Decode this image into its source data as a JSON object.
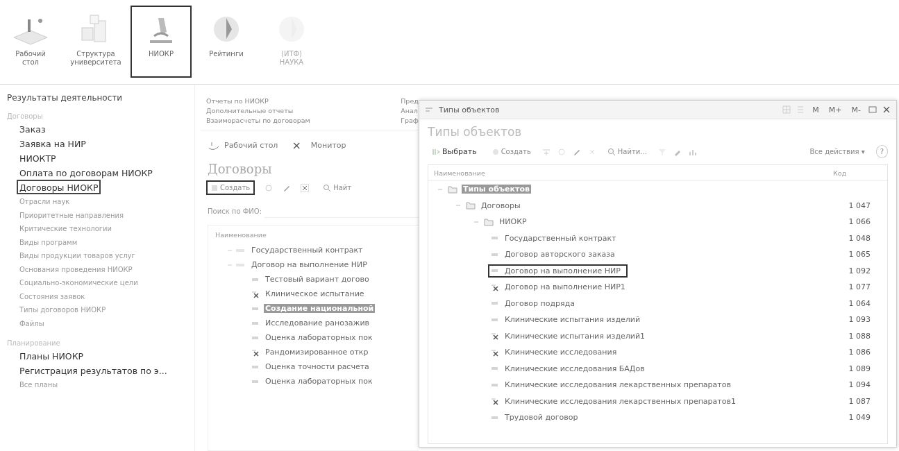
{
  "sections": [
    {
      "label": "Рабочий\nстол",
      "selected": false,
      "disabled": false
    },
    {
      "label": "Структура\nуниверситета",
      "selected": false,
      "disabled": false
    },
    {
      "label": "НИОКР",
      "selected": true,
      "disabled": false
    },
    {
      "label": "Рейтинги",
      "selected": false,
      "disabled": false
    },
    {
      "label": "(ИТФ)\nНАУКА",
      "selected": false,
      "disabled": true
    }
  ],
  "sidebar": {
    "title": "Результаты деятельности",
    "groups": [
      {
        "title": "Договоры",
        "items": [
          {
            "label": "Заказ",
            "important": true,
            "outlined": false
          },
          {
            "label": "Заявка на НИР",
            "important": true,
            "outlined": false
          },
          {
            "label": "НИОКТР",
            "important": true,
            "outlined": false
          },
          {
            "label": "Оплата по договорам НИОКР",
            "important": true,
            "outlined": false
          },
          {
            "label": "Договоры НИОКР",
            "important": true,
            "outlined": true
          },
          {
            "label": "Отрасли наук",
            "important": false,
            "outlined": false
          },
          {
            "label": "Приоритетные направления",
            "important": false,
            "outlined": false
          },
          {
            "label": "Критические технологии",
            "important": false,
            "outlined": false
          },
          {
            "label": "Виды программ",
            "important": false,
            "outlined": false
          },
          {
            "label": "Виды продукции товаров услуг",
            "important": false,
            "outlined": false
          },
          {
            "label": "Основания проведения НИОКР",
            "important": false,
            "outlined": false
          },
          {
            "label": "Социально-экономические цели",
            "important": false,
            "outlined": false
          },
          {
            "label": "Состояния заявок",
            "important": false,
            "outlined": false
          },
          {
            "label": "Типы договоров НИОКР",
            "important": false,
            "outlined": false
          },
          {
            "label": "Файлы",
            "important": false,
            "outlined": false
          }
        ]
      },
      {
        "title": "Планирование",
        "items": [
          {
            "label": "Планы НИОКР",
            "important": true,
            "outlined": false
          },
          {
            "label": "Регистрация результатов по э...",
            "important": true,
            "outlined": false
          },
          {
            "label": "Все планы",
            "important": false,
            "outlined": false
          }
        ]
      }
    ]
  },
  "reports": {
    "column_1": [
      "Отчеты по НИОКР",
      "Дополнительные отчеты",
      "Взаиморасчеты по договорам"
    ],
    "column_2": [
      "Пред",
      "Анал",
      "Граф"
    ]
  },
  "open_tabs": [
    {
      "label": "Рабочий стол",
      "close": "×"
    },
    {
      "label": "Монитор"
    }
  ],
  "list_form": {
    "title": "Договоры",
    "create": {
      "label": "Создать",
      "outlined": true
    },
    "find": "Найт",
    "search_label": "Поиск по ФИО:",
    "column": "Наименование",
    "rows": [
      {
        "label": "Государственный контракт",
        "deleted": false,
        "selected": false,
        "children": []
      },
      {
        "label": "Договор на выполнение НИР",
        "deleted": false,
        "selected": false,
        "children": [
          {
            "label": "Тестовый вариант догово",
            "deleted": false,
            "selected": false
          },
          {
            "label": "Клиническое испытание",
            "deleted": true,
            "selected": false
          },
          {
            "label": "Создание национальной",
            "deleted": false,
            "selected": true
          },
          {
            "label": "Исследование ранозажив",
            "deleted": false,
            "selected": false
          },
          {
            "label": "Оценка лабораторных пок",
            "deleted": false,
            "selected": false
          },
          {
            "label": "Рандомизированное откр",
            "deleted": true,
            "selected": false
          },
          {
            "label": "Оценка точности расчета",
            "deleted": false,
            "selected": false
          },
          {
            "label": "Оценка лабораторных пок",
            "deleted": false,
            "selected": false
          }
        ]
      }
    ]
  },
  "dialog": {
    "window_title": "Типы объектов",
    "window_buttons": [
      "M",
      "M+",
      "M-"
    ],
    "title": "Типы объектов",
    "toolbar": {
      "choose": "Выбрать",
      "create": "Создать",
      "find": "Найти...",
      "all_actions": "Все действия ▾",
      "help": "?"
    },
    "columns": [
      "Наименование",
      "Код"
    ],
    "tree": [
      {
        "label": "Типы объектов",
        "selected": true,
        "children": [
          {
            "label": "Договоры",
            "code": "1 047",
            "selected": false,
            "children": [
              {
                "label": "НИОКР",
                "code": "1 066",
                "selected": false,
                "children": [
                  {
                    "label": "Государственный контракт",
                    "code": "1 048",
                    "deleted": false,
                    "outlined": false
                  },
                  {
                    "label": "Договор авторского заказа",
                    "code": "1 065",
                    "deleted": false,
                    "outlined": false
                  },
                  {
                    "label": "Договор на выполнение НИР",
                    "code": "1 092",
                    "deleted": false,
                    "outlined": true
                  },
                  {
                    "label": "Договор на выполнение НИР1",
                    "code": "1 077",
                    "deleted": true,
                    "outlined": false
                  },
                  {
                    "label": "Договор подряда",
                    "code": "1 064",
                    "deleted": false,
                    "outlined": false
                  },
                  {
                    "label": "Клинические испытания изделий",
                    "code": "1 093",
                    "deleted": false,
                    "outlined": false
                  },
                  {
                    "label": "Клинические испытания изделий1",
                    "code": "1 088",
                    "deleted": true,
                    "outlined": false
                  },
                  {
                    "label": "Клинические исследования",
                    "code": "1 086",
                    "deleted": true,
                    "outlined": false
                  },
                  {
                    "label": "Клинические исследования БАДов",
                    "code": "1 089",
                    "deleted": false,
                    "outlined": false
                  },
                  {
                    "label": "Клинические исследования лекарственных препаратов",
                    "code": "1 094",
                    "deleted": false,
                    "outlined": false
                  },
                  {
                    "label": "Клинические исследования лекарственных препаратов1",
                    "code": "1 087",
                    "deleted": true,
                    "outlined": false
                  },
                  {
                    "label": "Трудовой договор",
                    "code": "1 049",
                    "deleted": false,
                    "outlined": false
                  }
                ]
              }
            ]
          }
        ]
      }
    ]
  }
}
